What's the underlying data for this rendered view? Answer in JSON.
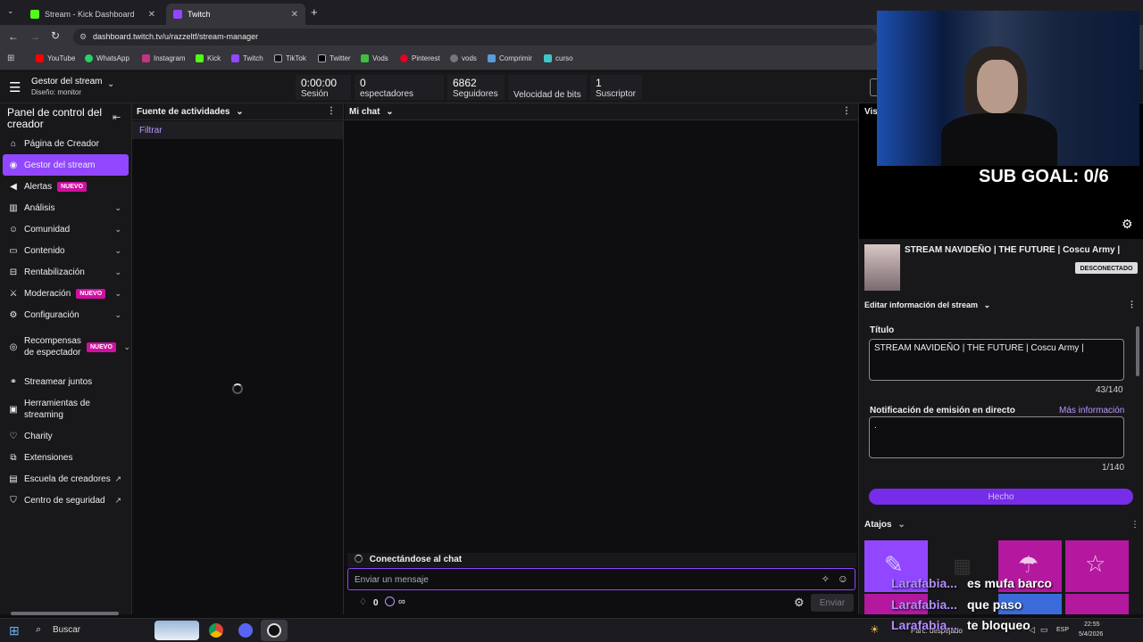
{
  "browser": {
    "tabs": [
      {
        "label": "Stream - Kick Dashboard"
      },
      {
        "label": "Twitch"
      }
    ],
    "url": "dashboard.twitch.tv/u/razzeltf/stream-manager",
    "bookmarks": [
      "YouTube",
      "WhatsApp",
      "Instagram",
      "Kick",
      "Twitch",
      "TikTok",
      "Twitter",
      "Vods",
      "Pinterest",
      "vods",
      "Comprimir",
      "curso"
    ]
  },
  "header": {
    "title": "Gestor del stream",
    "subtitle": "Diseño: monitor",
    "stats": [
      {
        "value": "0:00:00",
        "label": "Sesión"
      },
      {
        "value": "0",
        "label": "espectadores"
      },
      {
        "value": "6862",
        "label": "Seguidores"
      },
      {
        "value": "",
        "label": "Velocidad de bits"
      },
      {
        "value": "1",
        "label": "Suscriptor"
      }
    ]
  },
  "sidebar": {
    "title": "Panel de control del creador",
    "new_badge": "NUEVO",
    "items": [
      {
        "label": "Página de Creador"
      },
      {
        "label": "Gestor del stream"
      },
      {
        "label": "Alertas"
      },
      {
        "label": "Análisis"
      },
      {
        "label": "Comunidad"
      },
      {
        "label": "Contenido"
      },
      {
        "label": "Rentabilización"
      },
      {
        "label": "Moderación"
      },
      {
        "label": "Configuración"
      },
      {
        "label": "Recompensas de espectador"
      },
      {
        "label": "Streamear juntos"
      },
      {
        "label": "Herramientas de streaming"
      },
      {
        "label": "Charity"
      },
      {
        "label": "Extensiones"
      },
      {
        "label": "Escuela de creadores"
      },
      {
        "label": "Centro de seguridad"
      }
    ]
  },
  "activity": {
    "title": "Fuente de actividades",
    "filter": "Filtrar"
  },
  "chat": {
    "title": "Mi chat",
    "connecting": "Conectándose al chat",
    "placeholder": "Enviar un mensaje",
    "points": "0",
    "infinity": "∞",
    "send": "Enviar"
  },
  "right": {
    "preview_label": "Vis",
    "sub_goal": "SUB GOAL: 0/6",
    "stream_title": "STREAM NAVIDEÑO | THE FUTURE | Coscu Army |",
    "status": "DESCONECTADO",
    "edit_title": "Editar información del stream",
    "title_label": "Título",
    "title_value": "STREAM NAVIDEÑO | THE FUTURE | Coscu Army |",
    "title_count": "43/140",
    "notif_label": "Notificación de emisión en directo",
    "more_info": "Más información",
    "notif_value": ".",
    "notif_count": "1/140",
    "done": "Hecho",
    "shortcuts": "Atajos"
  },
  "overlay_chat": [
    {
      "name": "Larafabia...",
      "msg": "es mufa barco"
    },
    {
      "name": "Larafabia...",
      "msg": "que paso"
    },
    {
      "name": "Larafabia...",
      "msg": "te bloqueo"
    }
  ],
  "taskbar": {
    "search": "Buscar",
    "weather": "Parc. despejado",
    "lang": "ESP",
    "time": "22:55",
    "date": "5/4/2026"
  },
  "colors": {
    "accent": "#9147ff",
    "badge": "#d10fa0"
  }
}
